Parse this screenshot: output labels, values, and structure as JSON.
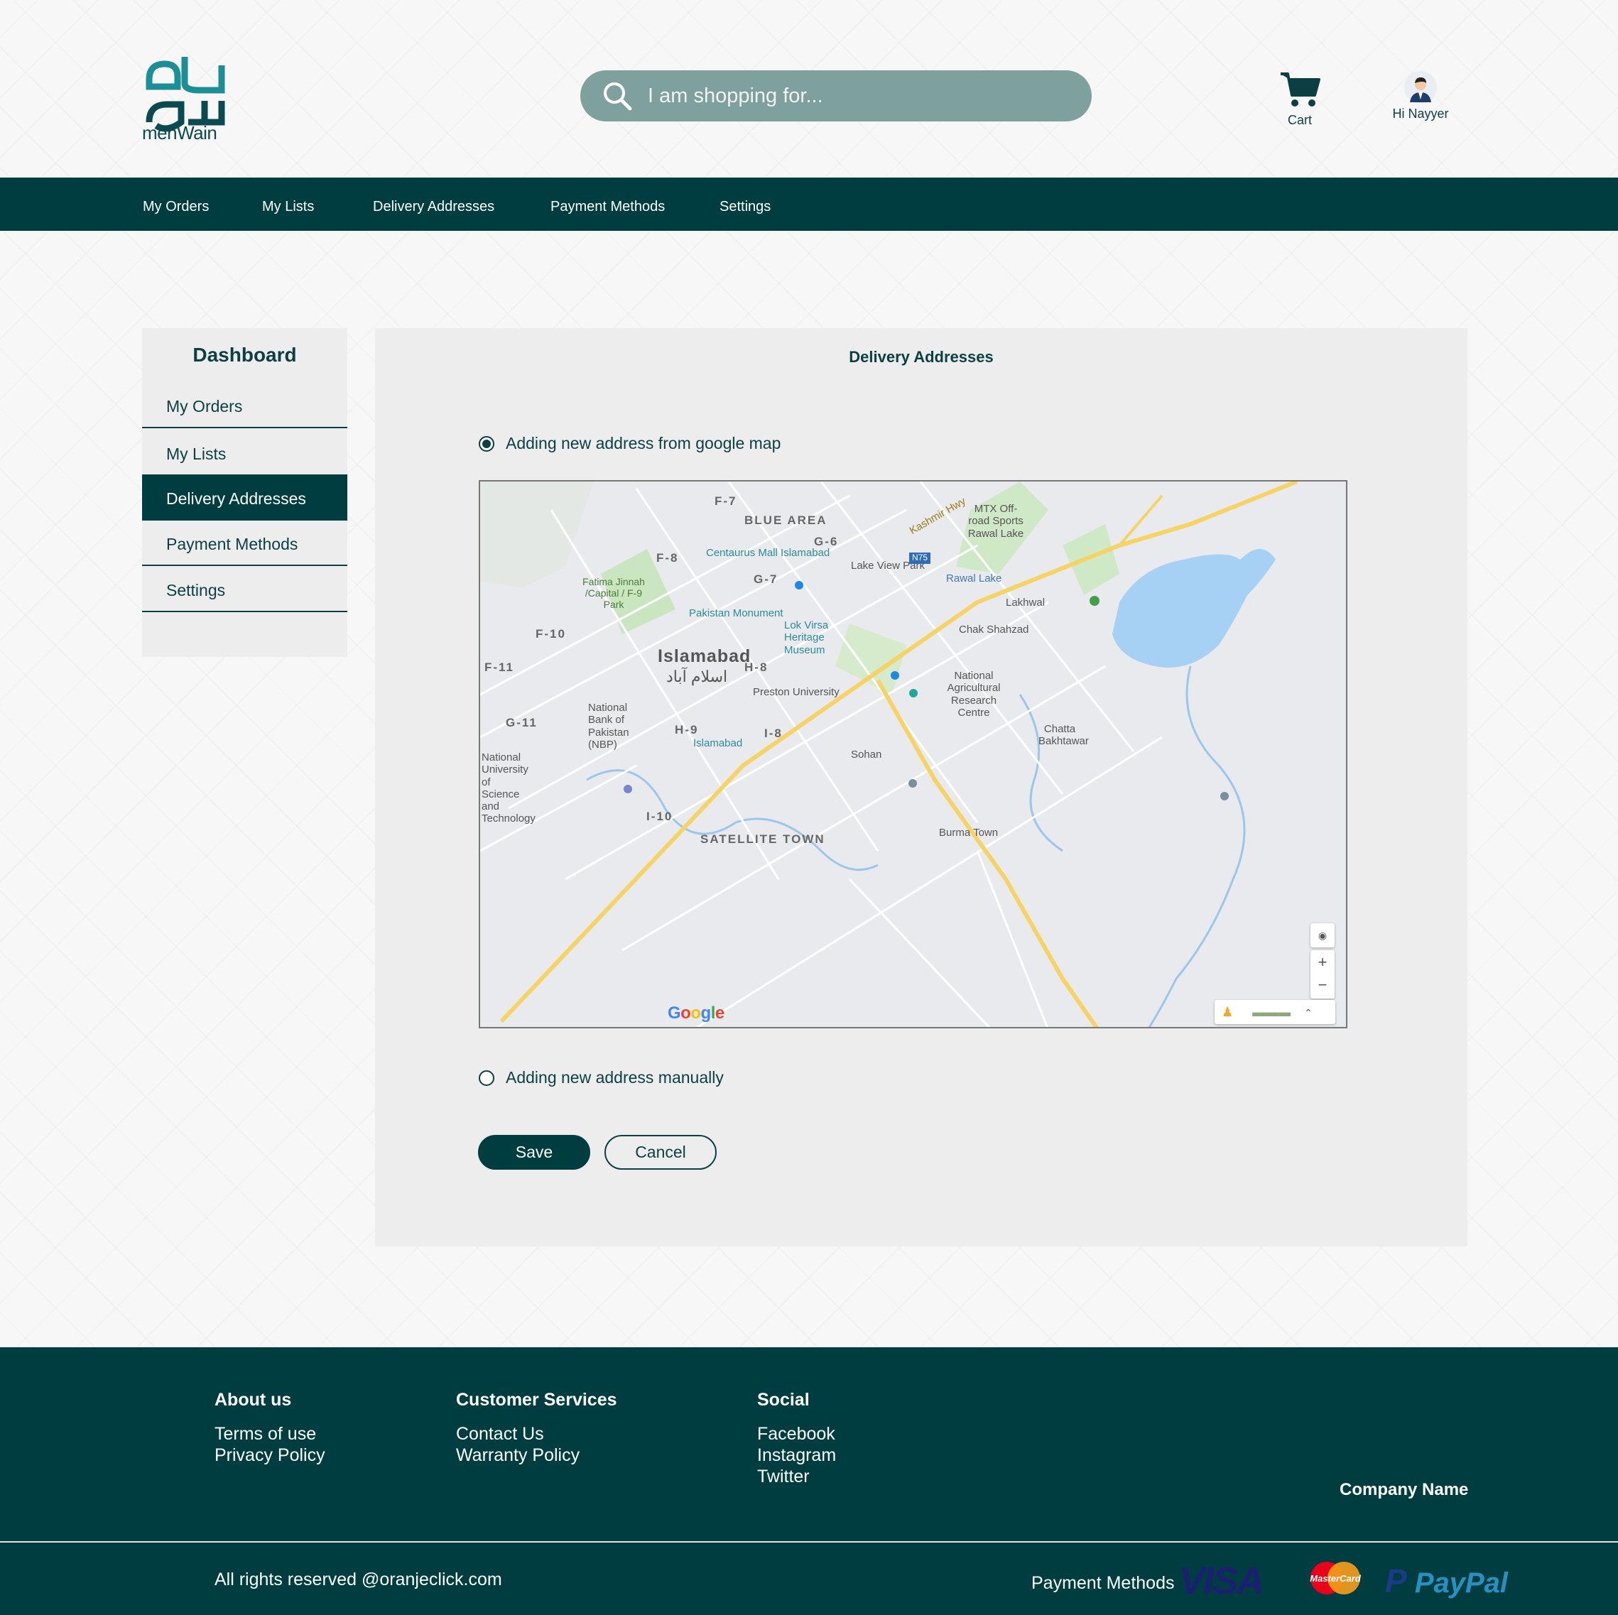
{
  "header": {
    "logo_text": "menWain",
    "search_placeholder": "I am shopping for...",
    "cart_label": "Cart",
    "user_label": "Hi Nayyer"
  },
  "topnav": [
    "My Orders",
    "My Lists",
    "Delivery Addresses",
    "Payment Methods",
    "Settings"
  ],
  "sidebar": {
    "title": "Dashboard",
    "items": [
      {
        "label": "My Orders",
        "active": false
      },
      {
        "label": "My Lists",
        "active": false
      },
      {
        "label": "Delivery Addresses",
        "active": true
      },
      {
        "label": "Payment Methods",
        "active": false
      },
      {
        "label": "Settings",
        "active": false
      }
    ]
  },
  "panel": {
    "title": "Delivery Addresses",
    "option_map": "Adding new address from google map",
    "option_manual": "Adding new address manually",
    "selected_option": "google map",
    "save_label": "Save",
    "cancel_label": "Cancel"
  },
  "map": {
    "city": "Islamabad",
    "city_urdu": "اسلام آباد",
    "sectors": [
      "F-7",
      "F-8",
      "F-10",
      "F-11",
      "G-6",
      "G-7",
      "G-11",
      "H-8",
      "H-9",
      "I-8",
      "I-10"
    ],
    "areas": [
      "BLUE AREA",
      "SATELLITE TOWN"
    ],
    "places": [
      "Centaurus Mall Islamabad",
      "Fatima Jinnah /Capital / F-9 Park",
      "Pakistan Monument",
      "Lok Virsa Heritage Museum",
      "Preston University",
      "National Bank of Pakistan (NBP)",
      "Islamabad",
      "National University of Science and Technology",
      "Lake View Park",
      "MTX Off-road Sports Rawal Lake",
      "Rawal Lake",
      "Lakhwal",
      "Chak Shahzad",
      "National Agricultural Research Centre",
      "Chatta Bakhtawar",
      "Sohan",
      "Burma Town"
    ],
    "road_labels": [
      "Kashmir Hwy",
      "N75"
    ],
    "attribution": "Google"
  },
  "footer": {
    "about_title": "About us",
    "about_links": [
      "Terms of use",
      "Privacy Policy"
    ],
    "service_title": "Customer Services",
    "service_links": [
      "Contact Us",
      "Warranty Policy"
    ],
    "social_title": "Social",
    "social_links": [
      "Facebook",
      "Instagram",
      "Twitter"
    ],
    "company": "Company Name",
    "rights": "All rights reserved @oranjeclick.com",
    "payment_label": "Payment Methods",
    "payment_brands": [
      "VISA",
      "MasterCard",
      "PayPal"
    ]
  },
  "colors": {
    "brand_dark": "#003d40",
    "search_bg": "#7fa19e",
    "panel_bg": "#ededed"
  }
}
